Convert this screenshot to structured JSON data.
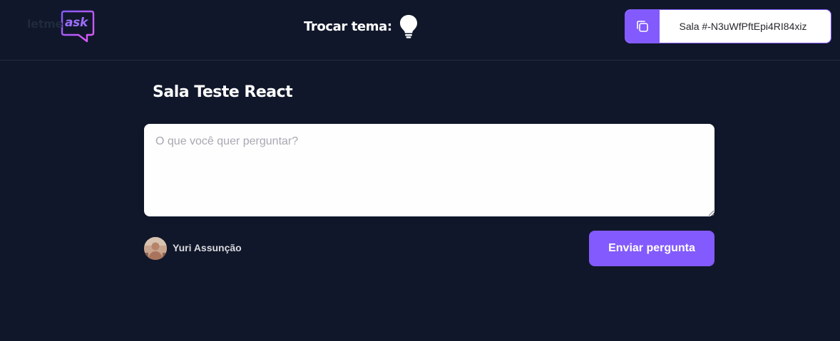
{
  "header": {
    "logo_text": "letmeask",
    "logo_prefix": "letme",
    "logo_suffix": "ask",
    "theme_label": "Trocar tema:",
    "theme_icon": "lightbulb-icon",
    "room_code": {
      "icon": "copy-icon",
      "text": "Sala #-N3uWfPftEpi4RI84xiz"
    }
  },
  "room": {
    "title": "Sala Teste React"
  },
  "question_form": {
    "placeholder": "O que você quer perguntar?",
    "value": "",
    "submit_label": "Enviar pergunta"
  },
  "user": {
    "name": "Yuri Assunção"
  },
  "colors": {
    "background": "#10172a",
    "accent": "#835afd",
    "text_light": "#ffffff",
    "input_background": "#fefefe",
    "placeholder": "#a8a8b3",
    "logo_gradient_start": "#835afd",
    "logo_gradient_end": "#e559f9"
  }
}
